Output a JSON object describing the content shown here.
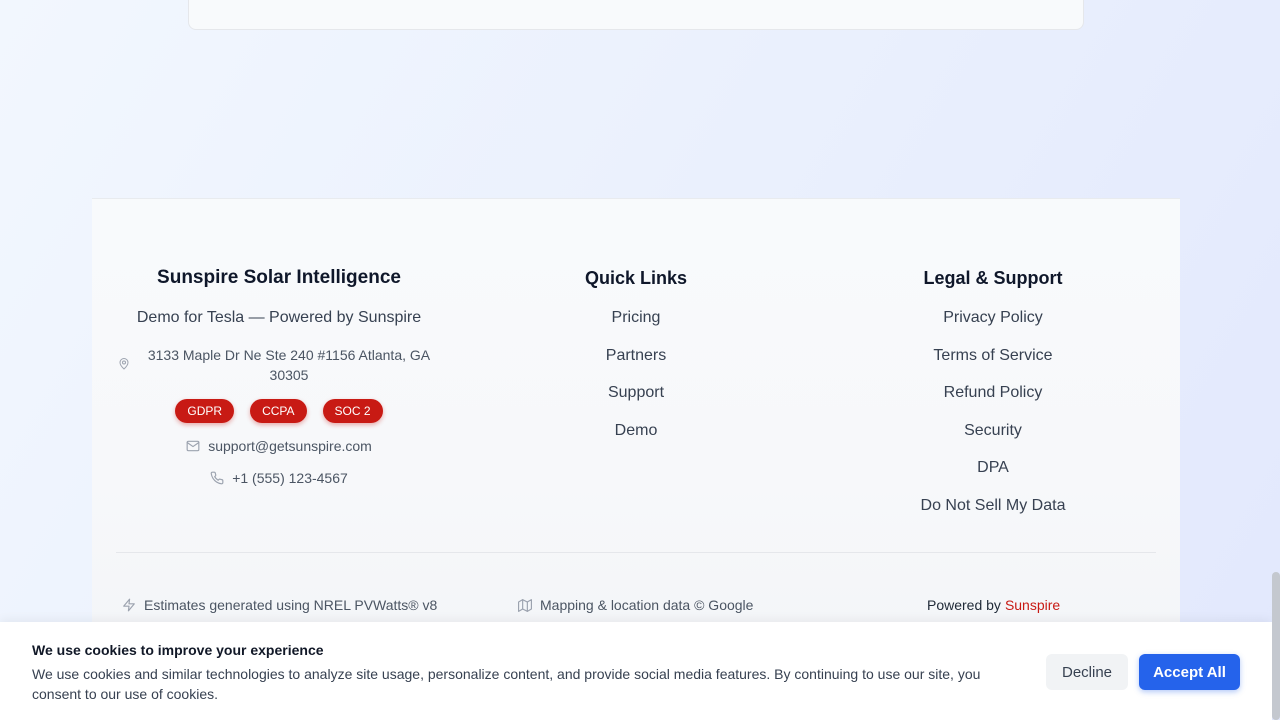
{
  "footer": {
    "brand": {
      "title": "Sunspire Solar Intelligence",
      "tagline": "Demo for Tesla — Powered by Sunspire",
      "address": "3133 Maple Dr Ne Ste 240 #1156 Atlanta, GA 30305",
      "badges": [
        "GDPR",
        "CCPA",
        "SOC 2"
      ],
      "email": "support@getsunspire.com",
      "phone": "+1 (555) 123-4567"
    },
    "quick_links": {
      "title": "Quick Links",
      "items": [
        "Pricing",
        "Partners",
        "Support",
        "Demo"
      ]
    },
    "legal": {
      "title": "Legal & Support",
      "items": [
        "Privacy Policy",
        "Terms of Service",
        "Refund Policy",
        "Security",
        "DPA",
        "Do Not Sell My Data"
      ]
    },
    "bottom": {
      "estimates": "Estimates generated using NREL PVWatts® v8",
      "mapping": "Mapping & location data © Google",
      "powered_prefix": "Powered by",
      "powered_brand": "Sunspire"
    }
  },
  "cookie": {
    "title": "We use cookies to improve your experience",
    "body": "We use cookies and similar technologies to analyze site usage, personalize content, and provide social media features. By continuing to use our site, you consent to our use of cookies.",
    "decline_label": "Decline",
    "accept_label": "Accept All"
  },
  "colors": {
    "brand_red": "#c81a14",
    "accept_blue": "#2563eb"
  },
  "icons": [
    "map-pin-icon",
    "mail-icon",
    "phone-icon",
    "zap-icon",
    "map-icon"
  ]
}
